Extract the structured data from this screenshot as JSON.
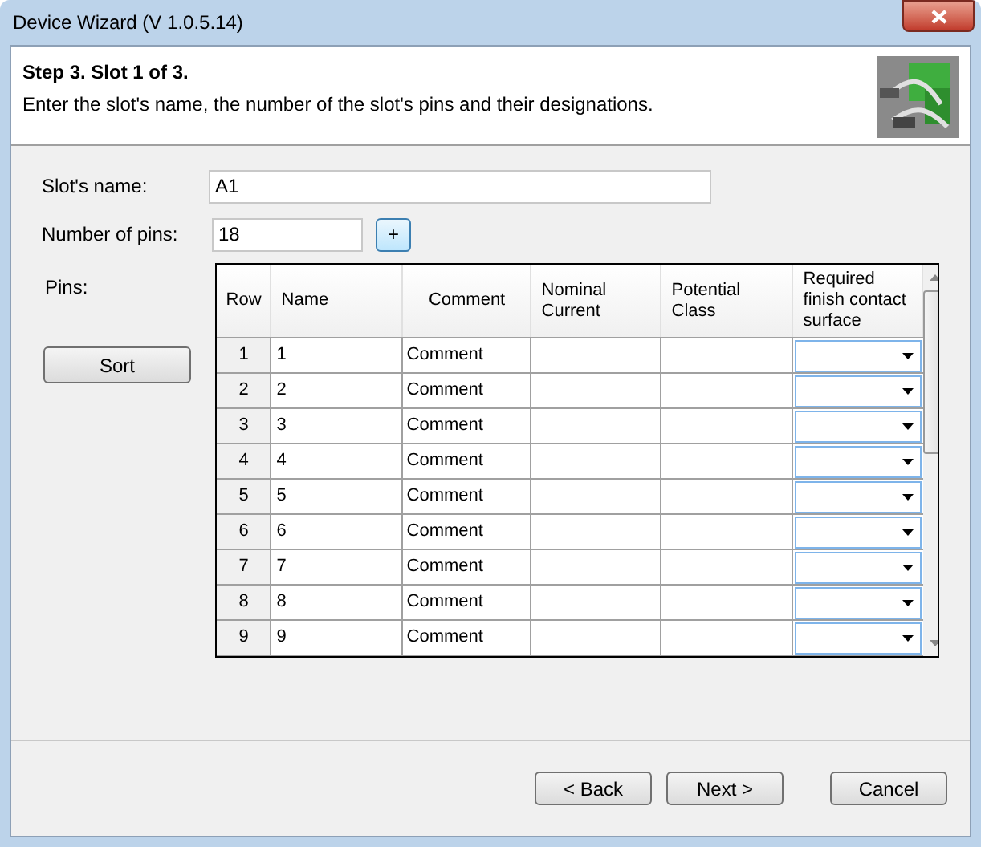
{
  "window": {
    "title": "Device Wizard (V 1.0.5.14)"
  },
  "header": {
    "title": "Step 3. Slot 1 of 3.",
    "description": "Enter the slot's name, the number of the slot's pins and their designations."
  },
  "slot_name": {
    "label": "Slot's name:",
    "value": "A1"
  },
  "pin_count": {
    "label": "Number of pins:",
    "value": "18",
    "add_button": "+"
  },
  "pins_label": "Pins:",
  "sort_button": "Sort",
  "table": {
    "columns": [
      "Row",
      "Name",
      "Comment",
      "Nominal Current",
      "Potential Class",
      "Required finish contact surface"
    ],
    "rows": [
      {
        "row": "1",
        "name": "1",
        "comment": "Comment"
      },
      {
        "row": "2",
        "name": "2",
        "comment": "Comment"
      },
      {
        "row": "3",
        "name": "3",
        "comment": "Comment"
      },
      {
        "row": "4",
        "name": "4",
        "comment": "Comment"
      },
      {
        "row": "5",
        "name": "5",
        "comment": "Comment"
      },
      {
        "row": "6",
        "name": "6",
        "comment": "Comment"
      },
      {
        "row": "7",
        "name": "7",
        "comment": "Comment"
      },
      {
        "row": "8",
        "name": "8",
        "comment": "Comment"
      },
      {
        "row": "9",
        "name": "9",
        "comment": "Comment"
      }
    ]
  },
  "buttons": [
    "< Back",
    "Next >",
    "Cancel"
  ]
}
